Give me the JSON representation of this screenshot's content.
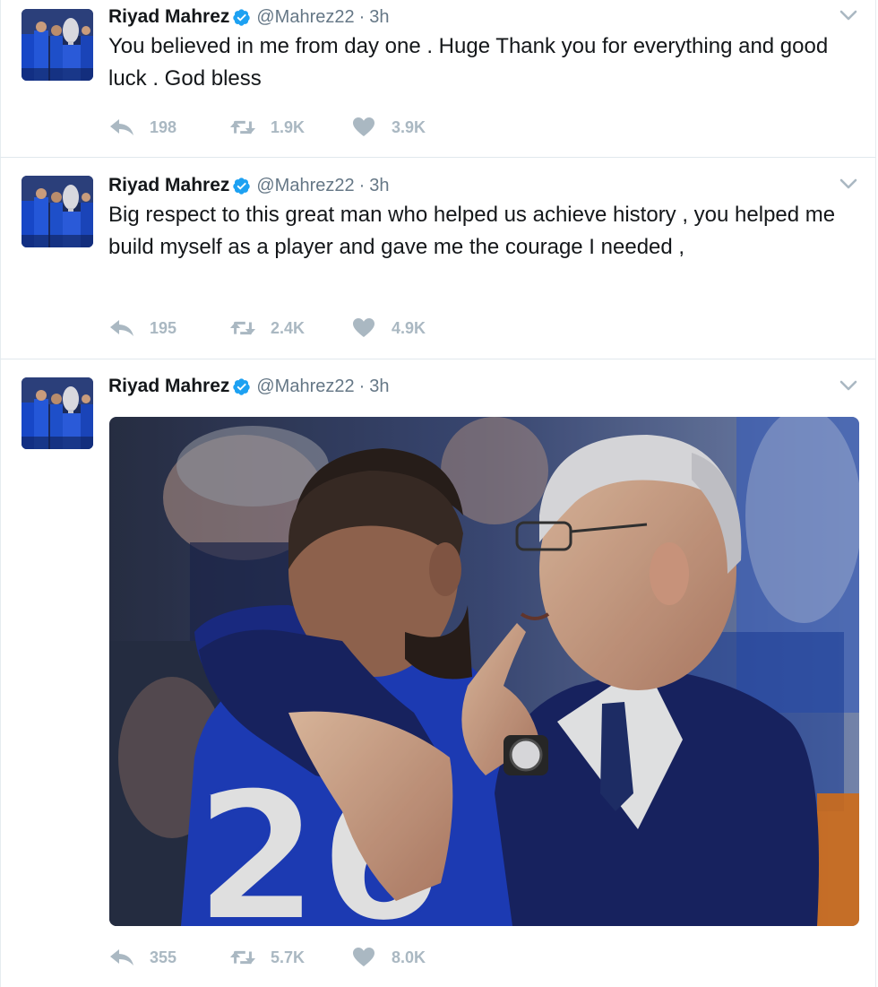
{
  "tweets": [
    {
      "name": "Riyad Mahrez",
      "handle": "@Mahrez22",
      "dot": "·",
      "time": "3h",
      "text": "You believed in me from day one . Huge Thank you for everything and good luck . God bless",
      "replies": "198",
      "retweets": "1.9K",
      "likes": "3.9K"
    },
    {
      "name": "Riyad Mahrez",
      "handle": "@Mahrez22",
      "dot": "·",
      "time": "3h",
      "text": "Big respect to this great man who helped us achieve history , you helped me build myself as a player and gave me the courage I needed ,",
      "replies": "195",
      "retweets": "2.4K",
      "likes": "4.9K"
    },
    {
      "name": "Riyad Mahrez",
      "handle": "@Mahrez22",
      "dot": "·",
      "time": "3h",
      "text": "",
      "replies": "355",
      "retweets": "5.7K",
      "likes": "8.0K",
      "media_jersey_number": "26"
    }
  ],
  "colors": {
    "verified": "#1da1f2",
    "action_gray": "#aab8c2",
    "meta_gray": "#657786",
    "border": "#e1e8ed"
  },
  "icons": [
    "verified-badge-icon",
    "chevron-down-icon",
    "reply-icon",
    "retweet-icon",
    "like-heart-icon"
  ]
}
